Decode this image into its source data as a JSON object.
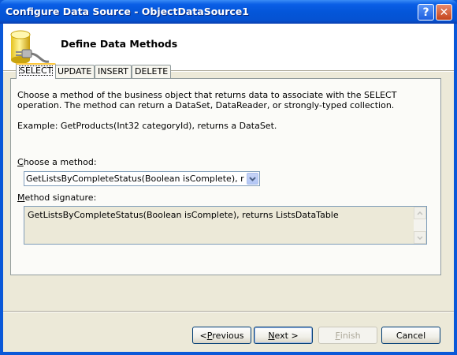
{
  "window": {
    "title": "Configure Data Source - ObjectDataSource1",
    "help_glyph": "?",
    "close_glyph": "✕"
  },
  "header": {
    "title": "Define Data Methods",
    "icon": "database-icon"
  },
  "tabs": [
    {
      "label": "SELECT",
      "active": true
    },
    {
      "label": "UPDATE",
      "active": false
    },
    {
      "label": "INSERT",
      "active": false
    },
    {
      "label": "DELETE",
      "active": false
    }
  ],
  "select_tab": {
    "description": "Choose a method of the business object that returns data to associate with the SELECT operation. The method can return a DataSet, DataReader, or strongly-typed collection.",
    "example": "Example: GetProducts(Int32 categoryId), returns a DataSet.",
    "choose_method_label_accel": "C",
    "choose_method_label_rest": "hoose a method:",
    "method_value": "GetListsByCompleteStatus(Boolean isComplete), returns L",
    "signature_label_accel": "M",
    "signature_label_rest": "ethod signature:",
    "signature_value": "GetListsByCompleteStatus(Boolean isComplete), returns ListsDataTable"
  },
  "buttons": {
    "previous_prefix": "< ",
    "previous_accel": "P",
    "previous_rest": "revious",
    "next_accel": "N",
    "next_rest": "ext >",
    "finish_accel": "F",
    "finish_rest": "inish",
    "cancel": "Cancel"
  },
  "colors": {
    "titlebar": "#0456d9",
    "dialog_bg": "#ece9d8",
    "active_tab_highlight": "#ffc83c"
  }
}
